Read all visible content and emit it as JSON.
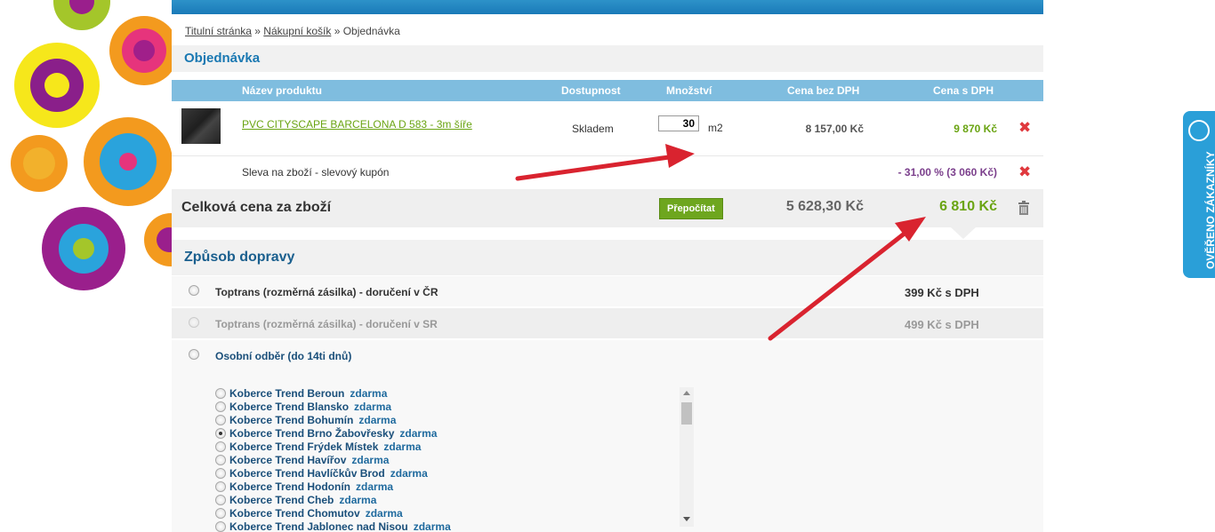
{
  "breadcrumb": {
    "home": "Titulní stránka",
    "cart": "Nákupní košík",
    "current": "Objednávka",
    "sep": "»"
  },
  "order": {
    "title": "Objednávka",
    "columns": {
      "name": "Název produktu",
      "availability": "Dostupnost",
      "quantity": "Množství",
      "price_net": "Cena bez DPH",
      "price_gross": "Cena s DPH"
    },
    "item": {
      "name": "PVC CITYSCAPE BARCELONA D 583 - 3m šíře",
      "availability": "Skladem",
      "quantity": "30",
      "unit": "m2",
      "price_net": "8 157,00 Kč",
      "price_gross": "9 870 Kč"
    },
    "discount": {
      "label": "Sleva na zboží - slevový kupón",
      "value": "- 31,00 % (3 060 Kč)"
    },
    "total": {
      "label": "Celková cena za zboží",
      "recalc_button": "Přepočítat",
      "net": "5 628,30 Kč",
      "gross": "6 810 Kč"
    }
  },
  "shipping": {
    "title": "Způsob dopravy",
    "options": [
      {
        "label": "Toptrans (rozměrná zásilka) - doručení v ČR",
        "price": "399 Kč s DPH"
      },
      {
        "label": "Toptrans (rozměrná zásilka) - doručení v SR",
        "price": "499 Kč s DPH"
      },
      {
        "label": "Osobní odběr (do 14ti dnů)",
        "price": ""
      }
    ],
    "free_label": "zdarma",
    "branches": [
      "Koberce Trend Beroun",
      "Koberce Trend Blansko",
      "Koberce Trend Bohumín",
      "Koberce Trend Brno Žabovřesky",
      "Koberce Trend Frýdek Místek",
      "Koberce Trend Havířov",
      "Koberce Trend Havlíčkův Brod",
      "Koberce Trend Hodonín",
      "Koberce Trend Cheb",
      "Koberce Trend Chomutov",
      "Koberce Trend Jablonec nad Nisou"
    ],
    "selected_branch": "Koberce Trend Brno Žabovřesky"
  },
  "badge": {
    "text": "OVĚŘENO ZÁKAZNÍKY"
  },
  "colors": {
    "accent": "#1a78b2",
    "table_header": "#7fbddf",
    "green": "#6aa412",
    "discount": "#7b3f8c",
    "delete": "#e0393e",
    "arrow": "#d9232f"
  }
}
